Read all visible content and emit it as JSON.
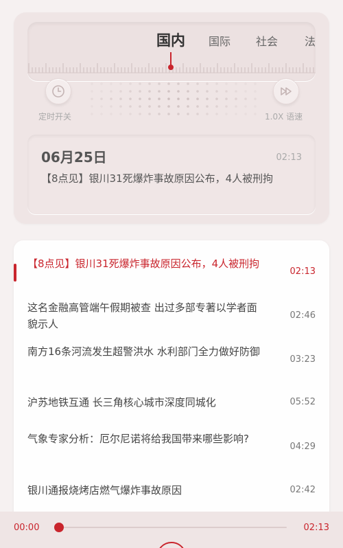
{
  "tuner": {
    "tabs": [
      {
        "label": "国内",
        "active": true
      },
      {
        "label": "国际",
        "active": false
      },
      {
        "label": "社会",
        "active": false
      },
      {
        "label": "法",
        "active": false
      }
    ]
  },
  "controls": {
    "timer_label": "定时开关",
    "timer_icon": "clock-icon",
    "speed_label": "1.0X 语速",
    "speed_icon": "fast-forward-icon"
  },
  "now_playing": {
    "date": "06月25日",
    "duration": "02:13",
    "title": "【8点见】银川31死爆炸事故原因公布，4人被刑拘"
  },
  "playlist": [
    {
      "title": "【8点见】银川31死爆炸事故原因公布，4人被刑拘",
      "duration": "02:13",
      "active": true
    },
    {
      "title": "这名金融高管端午假期被查 出过多部专著以学者面貌示人",
      "duration": "02:46",
      "active": false
    },
    {
      "title": "南方16条河流发生超警洪水 水利部门全力做好防御",
      "duration": "03:23",
      "active": false
    },
    {
      "title": "沪苏地铁互通 长三角核心城市深度同城化",
      "duration": "05:52",
      "active": false
    },
    {
      "title": "气象专家分析：厄尔尼诺将给我国带来哪些影响?",
      "duration": "04:29",
      "active": false
    },
    {
      "title": "银川通报烧烤店燃气爆炸事故原因",
      "duration": "02:42",
      "active": false
    }
  ],
  "player": {
    "current_time": "00:00",
    "total_time": "02:13",
    "progress": 0.0
  },
  "colors": {
    "accent": "#c9252d",
    "background": "#f6f1f1",
    "card": "#efe5e5"
  }
}
